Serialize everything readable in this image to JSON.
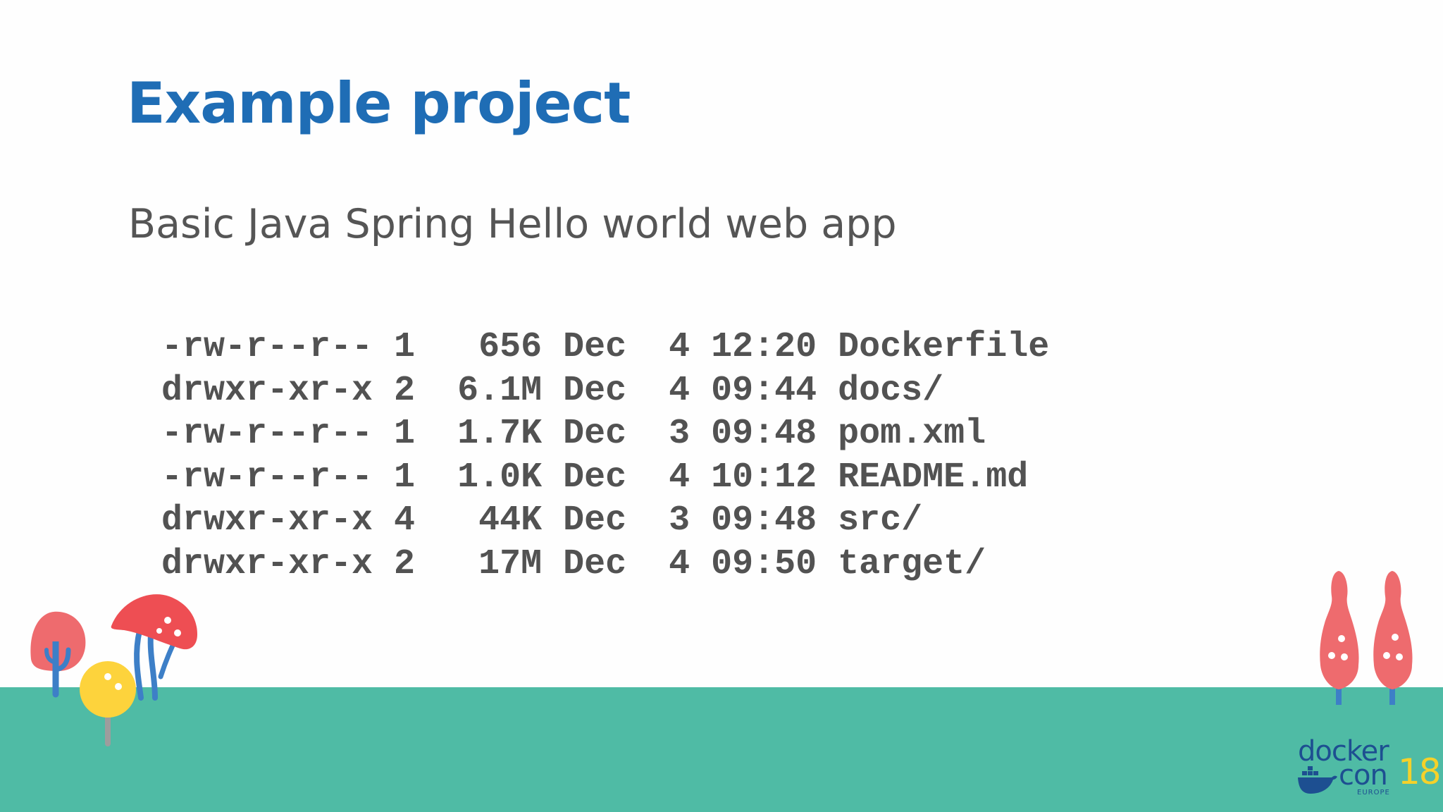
{
  "slide": {
    "title": "Example project",
    "subtitle": "Basic Java Spring Hello world web app"
  },
  "listing": [
    "-rw-r--r-- 1   656 Dec  4 12:20 Dockerfile",
    "drwxr-xr-x 2  6.1M Dec  4 09:44 docs/",
    "-rw-r--r-- 1  1.7K Dec  3 09:48 pom.xml",
    "-rw-r--r-- 1  1.0K Dec  4 10:12 README.md",
    "drwxr-xr-x 4   44K Dec  3 09:48 src/",
    "drwxr-xr-x 2   17M Dec  4 09:50 target/"
  ],
  "logo": {
    "word1": "docker",
    "word2": "con",
    "year": "18",
    "region": "EUROPE"
  },
  "colors": {
    "title": "#1f6db5",
    "text": "#555555",
    "ground": "#4fbba5",
    "tree_red": "#ee6b6e",
    "tree_yellow": "#fdd33c",
    "trunk_blue": "#3d7fc7",
    "logo_blue": "#1d4f91",
    "logo_yellow": "#f5d12a"
  }
}
